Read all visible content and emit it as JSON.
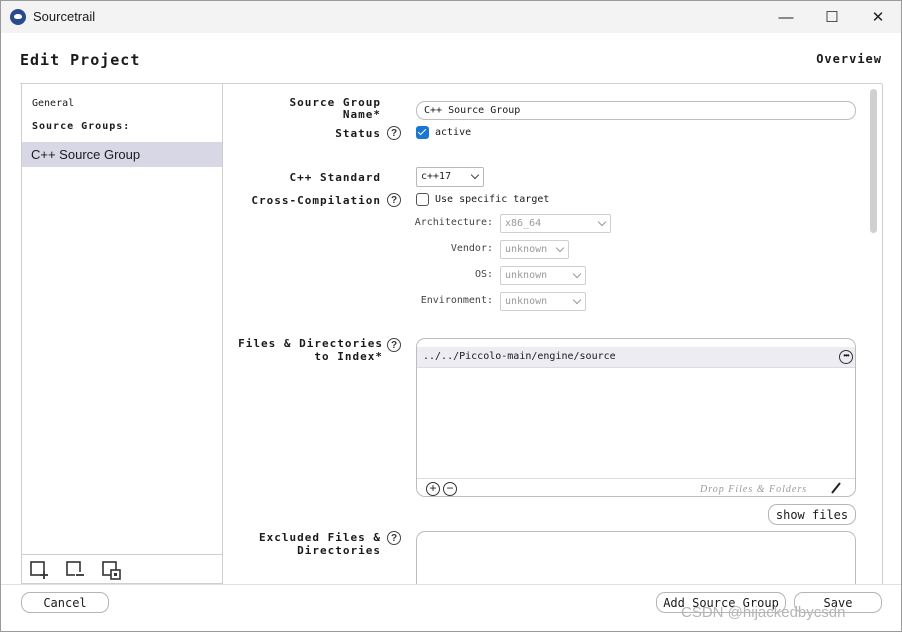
{
  "window": {
    "title": "Sourcetrail",
    "minimize_glyph": "—",
    "maximize_glyph": "☐",
    "close_glyph": "✕"
  },
  "header": {
    "title": "Edit Project",
    "overview_label": "Overview"
  },
  "sidebar": {
    "general_label": "General",
    "groups_label": "Source Groups:",
    "items": [
      {
        "label": "C++ Source Group",
        "selected": true
      }
    ],
    "bottom_icons": [
      "add-source-group-icon",
      "remove-source-group-icon",
      "duplicate-source-group-icon"
    ]
  },
  "form": {
    "source_group_name_label": "Source Group Name*",
    "source_group_name_value": "C++ Source Group",
    "status_label": "Status",
    "status_checkbox_label": "active",
    "status_checked": true,
    "cpp_standard_label": "C++ Standard",
    "cpp_standard_value": "c++17",
    "cross_compilation_label": "Cross-Compilation",
    "cross_compilation_checkbox_label": "Use specific target",
    "cross_compilation_checked": false,
    "architecture_label": "Architecture:",
    "architecture_value": "x86_64",
    "vendor_label": "Vendor:",
    "vendor_value": "unknown",
    "os_label": "OS:",
    "os_value": "unknown",
    "environment_label": "Environment:",
    "environment_value": "unknown",
    "files_label": "Files & Directories to Index*",
    "files_items": [
      "../../Piccolo-main/engine/source"
    ],
    "drop_hint": "Drop Files & Folders",
    "show_files_label": "show files",
    "excluded_label": "Excluded Files & Directories",
    "help_glyph": "?"
  },
  "footer": {
    "cancel_label": "Cancel",
    "add_group_label": "Add Source Group",
    "save_label": "Save"
  },
  "watermark": "CSDN @hijackedbycsdn",
  "colors": {
    "accent": "#1976d2",
    "selection": "#d7d7e5"
  }
}
